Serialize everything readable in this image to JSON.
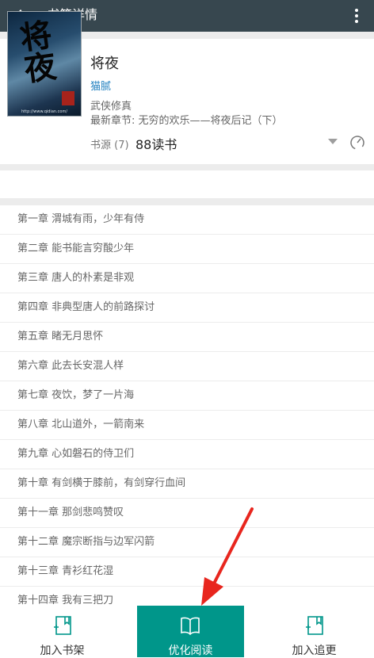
{
  "appbar": {
    "title": "书籍详情"
  },
  "book": {
    "title": "将夜",
    "author": "猫腻",
    "genre": "武侠修真",
    "latest_chapter": "最新章节: 无穷的欢乐——将夜后记（下）",
    "source_label": "书源 (7)",
    "source_name": "88读书",
    "cover": {
      "calligraphy": "将夜",
      "url": "http://www.qidian.com/"
    }
  },
  "chapters": [
    "第一章 渭城有雨，少年有侍",
    "第二章 能书能言穷酸少年",
    "第三章 唐人的朴素是非观",
    "第四章 非典型唐人的前路探讨",
    "第五章 睹无月思怀",
    "第六章 此去长安混人样",
    "第七章 夜饮，梦了一片海",
    "第八章 北山道外，一箭南来",
    "第九章 心如磐石的侍卫们",
    "第十章 有剑横于膝前，有剑穿行血间",
    "第十一章 那剑悲鸣赞叹",
    "第十二章 魔宗断指与边军闪箭",
    "第十三章 青衫红花湿",
    "第十四章 我有三把刀"
  ],
  "bottom_bar": {
    "add_shelf": "加入书架",
    "optimized_read": "优化阅读",
    "add_follow": "加入追更"
  },
  "colors": {
    "appbar": "#37474f",
    "accent": "#00968a",
    "author": "#1f7fbf",
    "annotation": "#e8261e"
  }
}
